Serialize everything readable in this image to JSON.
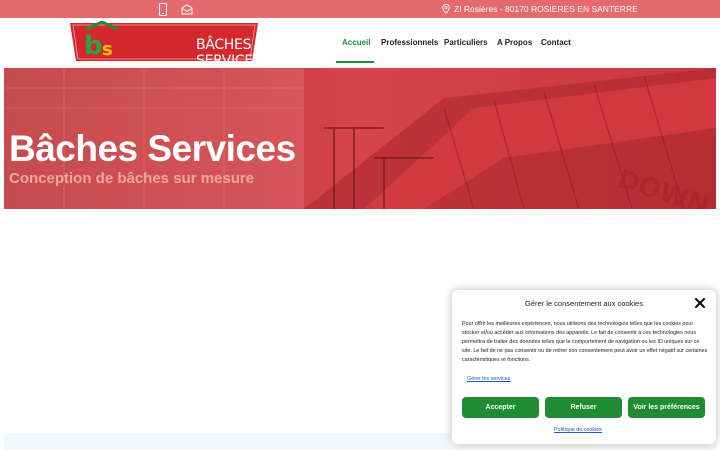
{
  "topbar": {
    "address": "ZI Rosières - 80170 ROSIERES EN SANTERRE"
  },
  "logo": {
    "text": "BÂCHES SERVICES"
  },
  "nav": {
    "items": [
      "Accueil",
      "Professionnels",
      "Particuliers",
      "A Propos",
      "Contact"
    ],
    "active": "Accueil"
  },
  "hero": {
    "title": "Bâches Services",
    "subtitle": "Conception de bâches sur mesure",
    "background_text": "DOWN"
  },
  "cookie": {
    "title": "Gérer le consentement aux cookies",
    "body": "Pour offrir les meilleures expériences, nous utilisons des technologies telles que les cookies pour stocker et/ou accéder aux informations des appareils. Le fait de consentir à ces technologies nous permettra de traiter des données telles que le comportement de navigation ou les ID uniques sur ce site. Le fait de ne pas consentir ou de retirer son consentement peut avoir un effet négatif sur certaines caractéristiques et fonctions.",
    "manage_link": "Gérer les services",
    "accept_label": "Accepter",
    "refuse_label": "Refuser",
    "prefs_label": "Voir les préférences",
    "policy_link": "Politique de cookies"
  },
  "colors": {
    "topbar": "#e46a6c",
    "accent_green": "#1d8f3c",
    "logo_red": "#d4282c",
    "hero_red": "#c9363a"
  }
}
